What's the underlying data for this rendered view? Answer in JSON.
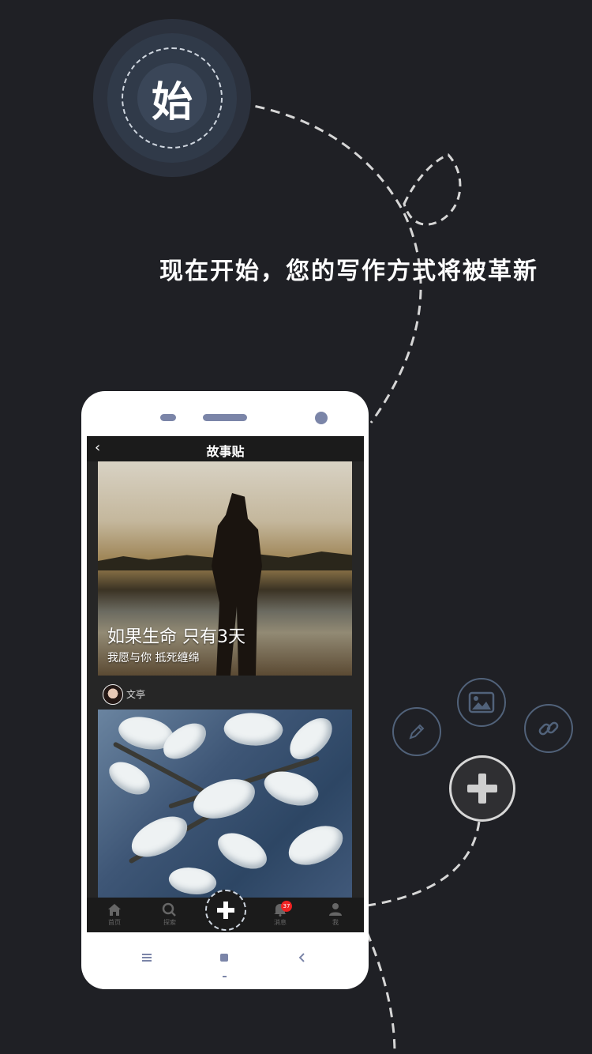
{
  "badge": {
    "char": "始"
  },
  "tagline": "现在开始，您的写作方式将被革新",
  "app": {
    "header": {
      "back_icon": "chevron-left-icon",
      "title": "故事贴"
    },
    "card1": {
      "title": "如果生命 只有3天",
      "subtitle": "我愿与你 抵死缠绵"
    },
    "author": {
      "name": "文亭"
    },
    "tabs": [
      {
        "label": "首页",
        "icon": "home-icon"
      },
      {
        "label": "探索",
        "icon": "search-icon"
      },
      {
        "label": "",
        "icon": "plus-icon"
      },
      {
        "label": "消息",
        "icon": "bell-icon",
        "badge": "37"
      },
      {
        "label": "我",
        "icon": "user-icon"
      }
    ]
  },
  "phone_nav": {
    "menu": "menu-icon",
    "home": "square-icon",
    "back": "back-icon"
  },
  "fabs": [
    "pencil-icon",
    "image-icon",
    "link-icon",
    "plus-icon"
  ],
  "colors": {
    "background": "#1f2025",
    "accent": "#51627a",
    "badge_red": "#e22222"
  }
}
